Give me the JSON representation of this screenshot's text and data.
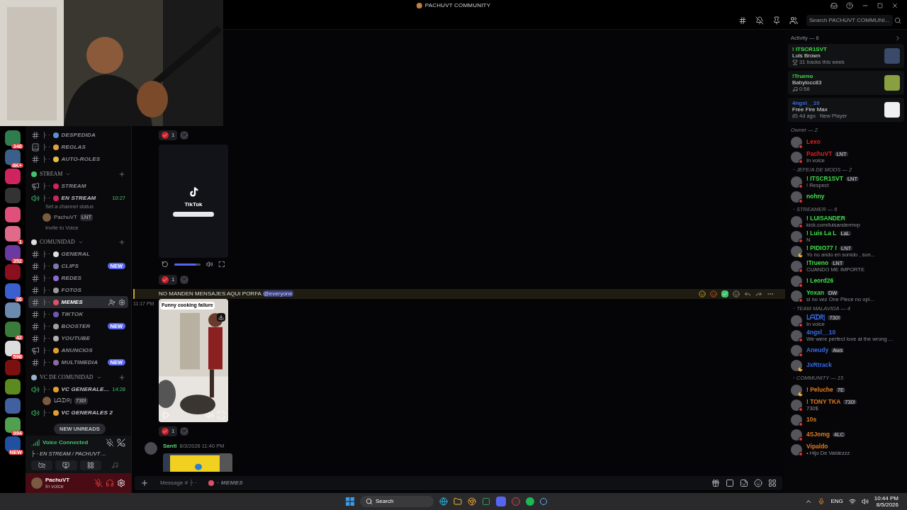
{
  "window": {
    "title": "PACHUVT COMMUNITY"
  },
  "header": {
    "search_placeholder": "Search PACHUVT COMMUNI..."
  },
  "servers": [
    {
      "color": "#2f7d4f",
      "badge": "346"
    },
    {
      "color": "#3a5f8a",
      "badge": "4K+"
    },
    {
      "color": "#d0245e"
    },
    {
      "color": "#333333"
    },
    {
      "color": "#e0507a"
    },
    {
      "color": "#e06a8a",
      "badge": "1"
    },
    {
      "color": "#6a3aa0",
      "badge": "352"
    },
    {
      "color": "#8a1020"
    },
    {
      "color": "#3a60d0",
      "badge": "36"
    },
    {
      "color": "#6a8ab0"
    },
    {
      "color": "#3a7a3a",
      "badge": "42"
    },
    {
      "color": "#dddddd",
      "badge": "598"
    },
    {
      "color": "#7a1010"
    },
    {
      "color": "#5a8a20"
    },
    {
      "color": "#4060a0"
    },
    {
      "color": "#50a050",
      "badge": "994"
    },
    {
      "color": "#2050a0",
      "badge": "NEW"
    }
  ],
  "channels": [
    {
      "kind": "text",
      "prefix": "├ ·",
      "name": "DESPEDIDA",
      "color": "#5b8fd6",
      "selected": false
    },
    {
      "kind": "rules",
      "prefix": "├ ·",
      "name": "REGLAS",
      "color": "#e0a040",
      "selected": false
    },
    {
      "kind": "text",
      "prefix": "├ ·",
      "name": "AUTO-ROLES",
      "color": "#e0c040",
      "selected": false
    },
    {
      "kind": "category",
      "name": "STREAM",
      "color": "#3ec46d"
    },
    {
      "kind": "announce",
      "prefix": "├ ·",
      "name": "STREAM",
      "color": "#d0245e",
      "selected": false
    },
    {
      "kind": "voice",
      "prefix": "├ ·",
      "name": "EN STREAM",
      "color": "#d0245e",
      "selected": false,
      "time": "10:27",
      "status": "Set a channel status",
      "users": [
        {
          "name": "PachuVT",
          "tag": "LNT"
        }
      ],
      "invite": "Invite to Voice"
    },
    {
      "kind": "category",
      "name": "COMUNIDAD",
      "color": "#dddddd"
    },
    {
      "kind": "text",
      "prefix": "├ ·",
      "name": "GENERAL",
      "color": "#dddddd",
      "selected": false
    },
    {
      "kind": "text",
      "prefix": "├ ·",
      "name": "CLIPS",
      "color": "#7a7ab0",
      "selected": false,
      "badge": "NEW"
    },
    {
      "kind": "text",
      "prefix": "├ ·",
      "name": "REDES",
      "color": "#8a6ad0",
      "selected": false
    },
    {
      "kind": "text",
      "prefix": "├ ·",
      "name": "FOTOS",
      "color": "#9a9a9a",
      "selected": false
    },
    {
      "kind": "text",
      "prefix": "├ ·",
      "name": "MEMES",
      "color": "#e0506a",
      "selected": true
    },
    {
      "kind": "text",
      "prefix": "├ ·",
      "name": "TIKTOK",
      "color": "#6a5ab0",
      "selected": false
    },
    {
      "kind": "text",
      "prefix": "├ ·",
      "name": "BOOSTER",
      "color": "#a0a0a0",
      "selected": false,
      "badge": "NEW"
    },
    {
      "kind": "text",
      "prefix": "├ ·",
      "name": "YOUTUBE",
      "color": "#b0b0b0",
      "selected": false
    },
    {
      "kind": "announce",
      "prefix": "├ ·",
      "name": "ANUNCIOS",
      "color": "#e0a030",
      "selected": false
    },
    {
      "kind": "text",
      "prefix": "├ ·",
      "name": "MULTIMEDIA",
      "color": "#8a6aa0",
      "selected": false,
      "badge": "NEW"
    },
    {
      "kind": "category",
      "name": "VC DE COMUNIDAD",
      "color": "#9ab0d0"
    },
    {
      "kind": "voice",
      "prefix": "├ ·",
      "name": "VC GENERALE...",
      "color": "#e0a030",
      "selected": false,
      "time": "14:28",
      "users": [
        {
          "name": "ᒪᗩᗪᖇ|",
          "tag": "730!"
        }
      ]
    },
    {
      "kind": "voice",
      "prefix": "├ ·",
      "name": "VC GENERALES 2",
      "color": "#e0a030",
      "selected": false
    }
  ],
  "new_unreads": "NEW UNREADS",
  "voice_panel": {
    "title": "Voice Connected",
    "channel": "├ · EN STREAM / PACHUVT ..."
  },
  "user_panel": {
    "name": "PachuVT",
    "status": "In voice"
  },
  "messages": [
    {
      "kind": "reactions",
      "count": "1"
    },
    {
      "kind": "tiktok",
      "label": "TikTok",
      "level": 0.85
    },
    {
      "kind": "reactions",
      "count": "1"
    },
    {
      "kind": "text",
      "time": "11:17 PM",
      "text": "NO MANDEN MENSAJES AQUI PORFA",
      "mention": "@everyone",
      "highlighted": true
    },
    {
      "kind": "video",
      "title": "Funny cooking failure"
    },
    {
      "kind": "reactions",
      "count": "1"
    },
    {
      "kind": "author",
      "author": "Santi",
      "date": "8/3/2026 11:40 PM"
    }
  ],
  "composer": {
    "placeholder": "Message # ├ ·",
    "channel": "· MEMES"
  },
  "activity": {
    "title": "Activity — 6",
    "cards": [
      {
        "user": "! ITSCR1SVT",
        "color": "#3ee04a",
        "title": "Luis Brown",
        "detail": "31 tracks this week"
      },
      {
        "user": "!Trueno",
        "color": "#3ee04a",
        "title": "Babylocc83",
        "detail": "0:58"
      },
      {
        "user": "4ngxl__10",
        "color": "#3a6ae0",
        "title": "Free Fire Max",
        "detail": "4d ago",
        "extra": "New Player"
      }
    ]
  },
  "member_groups": [
    {
      "title": "Owner — 2",
      "members": [
        {
          "name": "Lexo",
          "color": "#e02020",
          "kind": "dnd"
        },
        {
          "name": "PachuVT",
          "color": "#e02020",
          "tag": "LNT",
          "sub": "In voice",
          "kind": "dnd"
        }
      ]
    },
    {
      "title": "・JEFE/A DE MODS — 2",
      "members": [
        {
          "name": "! ITSCR1SVT",
          "color": "#3ee04a",
          "tag": "LNT",
          "sub": "! Respect",
          "kind": "dnd"
        },
        {
          "name": "nohny",
          "color": "#3ee04a",
          "kind": "dnd"
        }
      ]
    },
    {
      "title": "・STREAMER — 6",
      "members": [
        {
          "name": "! LUISANDER",
          "color": "#3ee04a",
          "sub": "kick.com/luisandermvp",
          "kind": "dnd"
        },
        {
          "name": "! Luis La L",
          "color": "#3ee04a",
          "tag": "LaL",
          "sub": "N",
          "kind": "dnd"
        },
        {
          "name": "! PIDIO77 !",
          "color": "#3ee04a",
          "tag": "LNT",
          "sub": "Yo no ando en sonido , sun...",
          "kind": "idle"
        },
        {
          "name": "!Trueno",
          "color": "#3ee04a",
          "tag": "LNT",
          "sub": "CUANDO ME IMPORTE",
          "kind": "dnd"
        },
        {
          "name": "! Leord26",
          "color": "#3ee04a",
          "kind": "dnd"
        },
        {
          "name": "Yoxan",
          "color": "#3ee04a",
          "tag": "DW",
          "sub": "si no vez One Piece no opi...",
          "kind": "dnd"
        }
      ]
    },
    {
      "title": "・TEAM MALAVIDA — 4",
      "members": [
        {
          "name": "ᒪᗩᗪᖇ|",
          "color": "#3a6ae0",
          "tag": "730!",
          "sub": "In voice",
          "kind": "dnd"
        },
        {
          "name": "4ngxl__10",
          "color": "#3a6ae0",
          "sub": "We were perfect love at the wrong ...",
          "kind": "dnd"
        },
        {
          "name": "Aneudy",
          "color": "#3a6ae0",
          "tag": "Aws",
          "kind": "dnd"
        },
        {
          "name": "JxRtrack",
          "color": "#3a6ae0",
          "kind": "idle"
        }
      ]
    },
    {
      "title": "・COMMUNITY — 15",
      "members": [
        {
          "name": "! Peluche",
          "color": "#e07a20",
          "tag": "7E",
          "kind": "idle"
        },
        {
          "name": "! TONY TKA",
          "color": "#e07a20",
          "tag": "730!",
          "sub": "730$",
          "kind": "dnd"
        },
        {
          "name": "10s",
          "color": "#e07a20",
          "kind": "dnd"
        },
        {
          "name": "4SJomg",
          "color": "#e07a20",
          "tag": "4LC",
          "kind": "dnd"
        },
        {
          "name": "Vipaldo",
          "color": "#e07a20",
          "sub": "• Hijo De Valdezzz",
          "kind": "dnd"
        }
      ]
    }
  ],
  "taskbar": {
    "search": "Search",
    "language": "ENG",
    "time": "10:44 PM",
    "date": "8/5/2026"
  }
}
